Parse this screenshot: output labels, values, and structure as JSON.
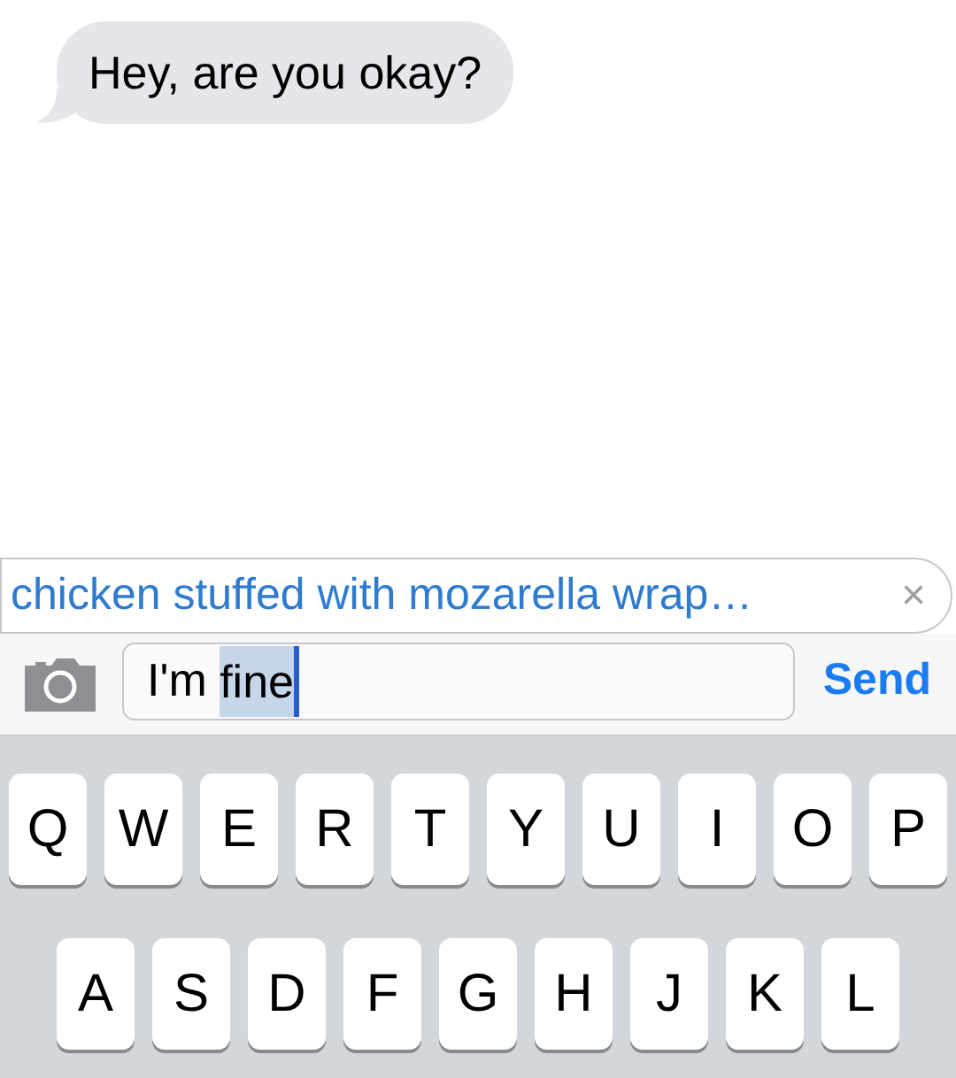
{
  "messages": [
    {
      "kind": "received",
      "text": "Hey, are you okay?"
    }
  ],
  "autocorrect": {
    "suggestion": "chicken stuffed with mozarella wrap…",
    "dismiss": "×"
  },
  "composer": {
    "text": "I'm ",
    "highlighted_text": "fine",
    "send": "Send"
  },
  "keyboard": {
    "rows": [
      [
        "Q",
        "W",
        "E",
        "R",
        "T",
        "Y",
        "U",
        "I",
        "O",
        "P"
      ],
      [
        "A",
        "S",
        "D",
        "F",
        "G",
        "H",
        "J",
        "K",
        "L"
      ]
    ]
  }
}
